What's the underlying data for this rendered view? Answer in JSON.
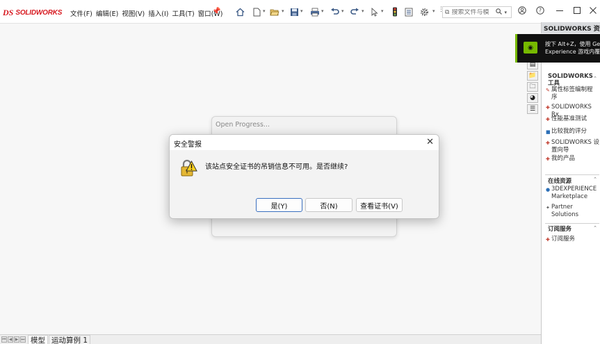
{
  "app": {
    "logo_mark": "DS",
    "brand": "SOLIDWORKS"
  },
  "menu": [
    "文件(F)",
    "编辑(E)",
    "视图(V)",
    "插入(I)",
    "工具(T)",
    "窗口(W)"
  ],
  "toolbar_icons": [
    "home-icon",
    "new-document-icon",
    "open-icon",
    "save-icon",
    "print-icon",
    "undo-icon",
    "redo-icon",
    "select-icon",
    "traffic-light-icon",
    "file-properties-icon",
    "options-gear-icon"
  ],
  "search": {
    "placeholder": "搜索文件与模"
  },
  "task_pane": {
    "title": "SOLIDWORKS 资源",
    "nvidia": {
      "line1": "按下 Alt+Z，使用 GeForce",
      "line2": "Experience 游戏内覆盖"
    },
    "sections": [
      {
        "title_line1": "SOLIDWORKS",
        "title_line2": "工具",
        "items": [
          {
            "line1": "属性标签编制程",
            "line2": "序"
          },
          {
            "line1": "SOLIDWORKS Rx",
            "line2": ""
          },
          {
            "line1": "性能基准测试",
            "line2": ""
          },
          {
            "line1": "比较我的评分",
            "line2": ""
          },
          {
            "line1": "SOLIDWORKS 设",
            "line2": "置向导"
          },
          {
            "line1": "我的产品",
            "line2": ""
          }
        ]
      },
      {
        "title_line1": "在线资源",
        "items": [
          {
            "line1": "3DEXPERIENCE",
            "line2": "Marketplace"
          },
          {
            "line1": "Partner Solutions",
            "line2": ""
          }
        ]
      },
      {
        "title_line1": "订阅服务",
        "items": [
          {
            "line1": "订阅服务",
            "line2": ""
          }
        ]
      }
    ]
  },
  "bottom_tabs": [
    "模型",
    "运动算例 1"
  ],
  "progress": {
    "title": "Open Progress..."
  },
  "dialog": {
    "title": "安全警报",
    "message": "该站点安全证书的吊销信息不可用。是否继续?",
    "buttons": {
      "yes": "是(Y)",
      "no": "否(N)",
      "view_cert": "查看证书(V)"
    }
  }
}
